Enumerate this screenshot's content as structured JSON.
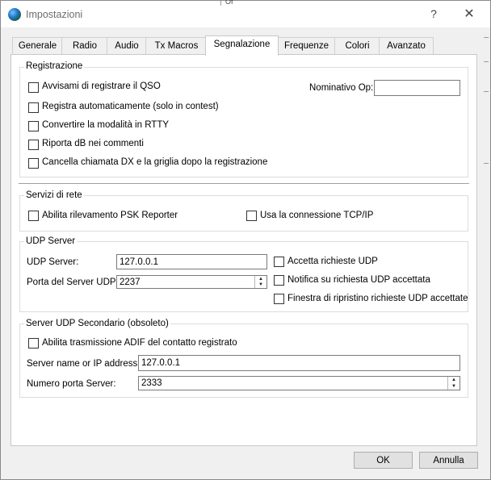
{
  "window": {
    "title": "Impostazioni",
    "help": "?",
    "close": "✕"
  },
  "tabs": [
    {
      "label": "Generale"
    },
    {
      "label": "Radio"
    },
    {
      "label": "Audio"
    },
    {
      "label": "Tx Macros"
    },
    {
      "label": "Segnalazione",
      "active": true
    },
    {
      "label": "Frequenze"
    },
    {
      "label": "Colori"
    },
    {
      "label": "Avanzato"
    }
  ],
  "registrazione": {
    "title": "Registrazione",
    "options": [
      {
        "label": "Avvisami di registrare il QSO",
        "checked": false
      },
      {
        "label": "Registra automaticamente (solo in contest)",
        "checked": false
      },
      {
        "label": "Convertire la modalità in RTTY",
        "checked": false
      },
      {
        "label": "Riporta dB nei commenti",
        "checked": false
      },
      {
        "label": "Cancella chiamata DX e la griglia dopo la registrazione",
        "checked": false
      }
    ],
    "operator_label": "Nominativo Op:",
    "operator_value": ""
  },
  "servizi": {
    "title": "Servizi di rete",
    "psk_label": "Abilita rilevamento PSK Reporter",
    "tcp_label": "Usa la connessione TCP/IP"
  },
  "udp": {
    "title": "UDP Server",
    "server_label": "UDP Server:",
    "server_value": "127.0.0.1",
    "port_label": "Porta del Server UDP:",
    "port_value": "2237",
    "accept_label": "Accetta richieste UDP",
    "notify_label": "Notifica su richiesta UDP accettata",
    "restore_label": "Finestra di ripristino richieste UDP accettate"
  },
  "udp2": {
    "title": "Server UDP Secondario (obsoleto)",
    "adif_label": "Abilita trasmissione ADIF del contatto registrato",
    "name_label": "Server name or IP address:",
    "name_value": "127.0.0.1",
    "port_label": "Numero porta Server:",
    "port_value": "2333"
  },
  "buttons": {
    "ok": "OK",
    "cancel": "Annulla"
  },
  "background": {
    "fragment": "Of"
  }
}
